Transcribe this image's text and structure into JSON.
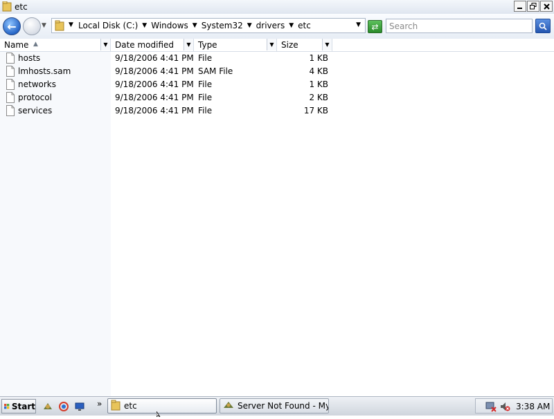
{
  "window": {
    "title": "etc"
  },
  "navigation": {
    "breadcrumbs": [
      "Local Disk (C:)",
      "Windows",
      "System32",
      "drivers",
      "etc"
    ],
    "search_placeholder": "Search"
  },
  "columns": {
    "name": "Name",
    "date_modified": "Date modified",
    "type": "Type",
    "size": "Size"
  },
  "files": [
    {
      "name": "hosts",
      "date": "9/18/2006 4:41 PM",
      "type": "File",
      "size": "1 KB"
    },
    {
      "name": "lmhosts.sam",
      "date": "9/18/2006 4:41 PM",
      "type": "SAM File",
      "size": "4 KB"
    },
    {
      "name": "networks",
      "date": "9/18/2006 4:41 PM",
      "type": "File",
      "size": "1 KB"
    },
    {
      "name": "protocol",
      "date": "9/18/2006 4:41 PM",
      "type": "File",
      "size": "2 KB"
    },
    {
      "name": "services",
      "date": "9/18/2006 4:41 PM",
      "type": "File",
      "size": "17 KB"
    }
  ],
  "taskbar": {
    "start_label": "Start",
    "more_label": "»",
    "tasks": [
      {
        "label": "etc",
        "active": true
      },
      {
        "label": "Server Not Found - My...",
        "active": false
      }
    ],
    "clock": "3:38 AM"
  },
  "colors": {
    "accent": "#2766c7",
    "refresh_green": "#2a8a2a",
    "header_border": "#d6dde7"
  }
}
